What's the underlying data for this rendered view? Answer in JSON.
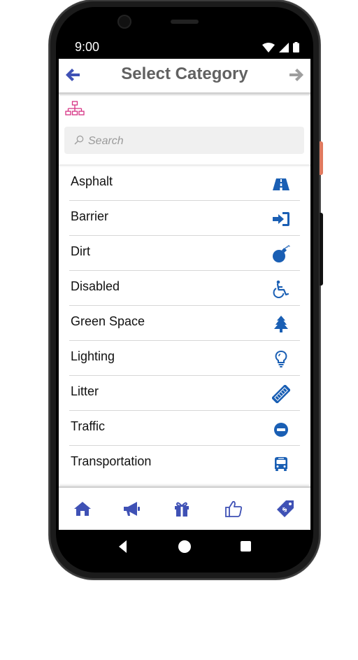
{
  "status": {
    "time": "9:00"
  },
  "header": {
    "title": "Select Category"
  },
  "search": {
    "placeholder": "Search"
  },
  "categories": [
    {
      "label": "Asphalt",
      "icon": "road-icon"
    },
    {
      "label": "Barrier",
      "icon": "sign-in-icon"
    },
    {
      "label": "Dirt",
      "icon": "bomb-icon"
    },
    {
      "label": "Disabled",
      "icon": "wheelchair-icon"
    },
    {
      "label": "Green Space",
      "icon": "tree-icon"
    },
    {
      "label": "Lighting",
      "icon": "lightbulb-icon"
    },
    {
      "label": "Litter",
      "icon": "ticket-icon"
    },
    {
      "label": "Traffic",
      "icon": "minus-circle-icon"
    },
    {
      "label": "Transportation",
      "icon": "bus-icon"
    }
  ],
  "tabs": [
    {
      "name": "home",
      "icon": "home-icon"
    },
    {
      "name": "announcements",
      "icon": "megaphone-icon"
    },
    {
      "name": "rewards",
      "icon": "gift-icon"
    },
    {
      "name": "likes",
      "icon": "thumbs-up-icon"
    },
    {
      "name": "offers",
      "icon": "price-tag-icon"
    }
  ],
  "colors": {
    "accent": "#3f51b5",
    "icon_blue": "#1a5fb4",
    "header_arrow_back": "#3f51b5",
    "header_arrow_forward": "#9e9e9e",
    "hierarchy_icon": "#d63384",
    "title_text": "#616161"
  }
}
